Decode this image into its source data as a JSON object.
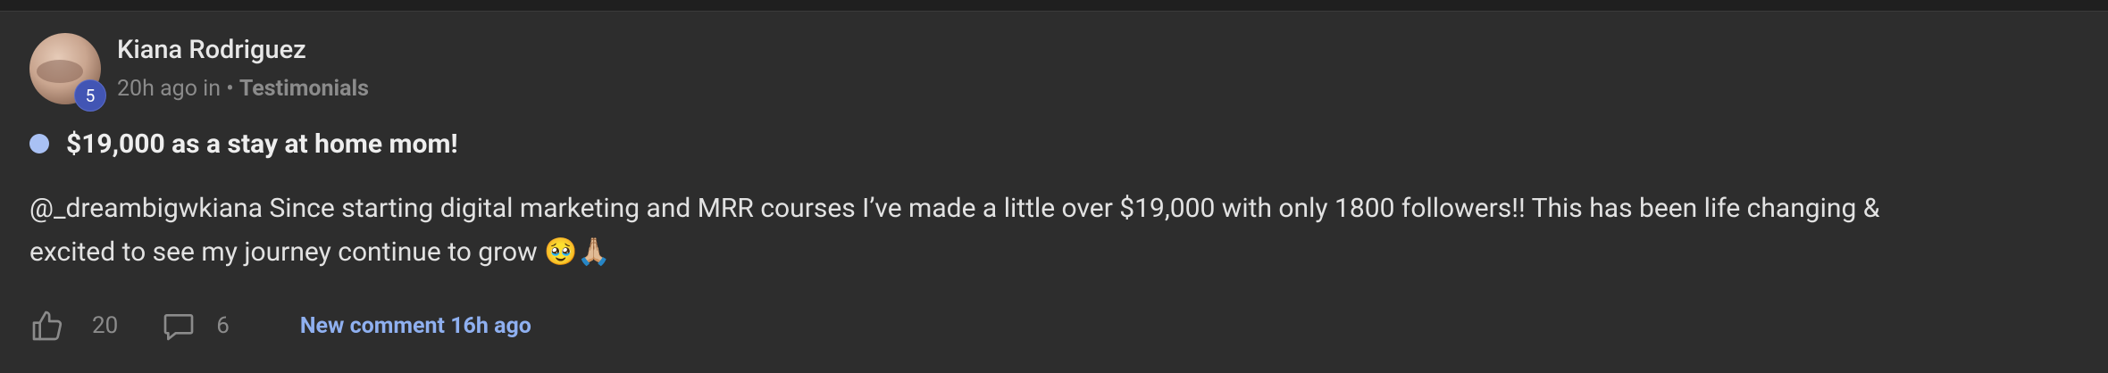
{
  "post": {
    "author": "Kiana Rodriguez",
    "level": "5",
    "time": "20h ago in",
    "separator": " • ",
    "category": "Testimonials",
    "title": "$19,000 as a stay at home mom!",
    "body_line1": "@_dreambigwkiana Since starting digital marketing and MRR courses I’ve made a little over $19,000 with only 1800 followers!! This has been life changing &",
    "body_line2": "excited to see my journey continue to grow 🥹🙏🏼",
    "likes": "20",
    "comments": "6",
    "new_comment": "New comment 16h ago"
  },
  "colors": {
    "card_bg": "#2d2d2d",
    "dot": "#a9c1f4",
    "badge": "#4255b4",
    "link": "#8fb0f0"
  },
  "icons": [
    "thumbs-up-icon",
    "comment-icon"
  ]
}
